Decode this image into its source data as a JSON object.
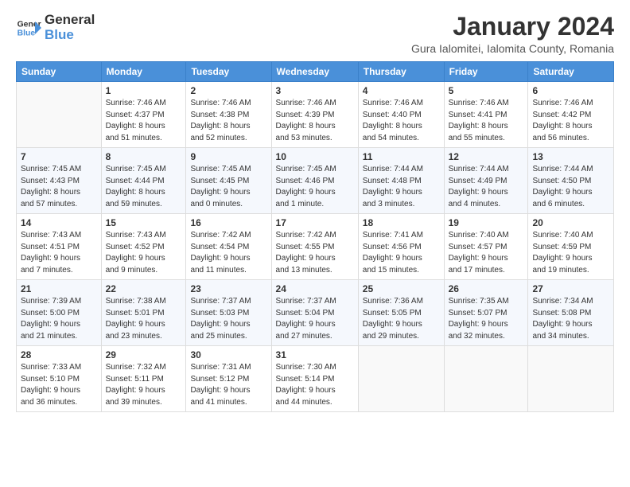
{
  "logo": {
    "line1": "General",
    "line2": "Blue"
  },
  "title": "January 2024",
  "subtitle": "Gura Ialomitei, Ialomita County, Romania",
  "headers": [
    "Sunday",
    "Monday",
    "Tuesday",
    "Wednesday",
    "Thursday",
    "Friday",
    "Saturday"
  ],
  "weeks": [
    [
      {
        "day": "",
        "info": ""
      },
      {
        "day": "1",
        "info": "Sunrise: 7:46 AM\nSunset: 4:37 PM\nDaylight: 8 hours\nand 51 minutes."
      },
      {
        "day": "2",
        "info": "Sunrise: 7:46 AM\nSunset: 4:38 PM\nDaylight: 8 hours\nand 52 minutes."
      },
      {
        "day": "3",
        "info": "Sunrise: 7:46 AM\nSunset: 4:39 PM\nDaylight: 8 hours\nand 53 minutes."
      },
      {
        "day": "4",
        "info": "Sunrise: 7:46 AM\nSunset: 4:40 PM\nDaylight: 8 hours\nand 54 minutes."
      },
      {
        "day": "5",
        "info": "Sunrise: 7:46 AM\nSunset: 4:41 PM\nDaylight: 8 hours\nand 55 minutes."
      },
      {
        "day": "6",
        "info": "Sunrise: 7:46 AM\nSunset: 4:42 PM\nDaylight: 8 hours\nand 56 minutes."
      }
    ],
    [
      {
        "day": "7",
        "info": "Sunrise: 7:45 AM\nSunset: 4:43 PM\nDaylight: 8 hours\nand 57 minutes."
      },
      {
        "day": "8",
        "info": "Sunrise: 7:45 AM\nSunset: 4:44 PM\nDaylight: 8 hours\nand 59 minutes."
      },
      {
        "day": "9",
        "info": "Sunrise: 7:45 AM\nSunset: 4:45 PM\nDaylight: 9 hours\nand 0 minutes."
      },
      {
        "day": "10",
        "info": "Sunrise: 7:45 AM\nSunset: 4:46 PM\nDaylight: 9 hours\nand 1 minute."
      },
      {
        "day": "11",
        "info": "Sunrise: 7:44 AM\nSunset: 4:48 PM\nDaylight: 9 hours\nand 3 minutes."
      },
      {
        "day": "12",
        "info": "Sunrise: 7:44 AM\nSunset: 4:49 PM\nDaylight: 9 hours\nand 4 minutes."
      },
      {
        "day": "13",
        "info": "Sunrise: 7:44 AM\nSunset: 4:50 PM\nDaylight: 9 hours\nand 6 minutes."
      }
    ],
    [
      {
        "day": "14",
        "info": "Sunrise: 7:43 AM\nSunset: 4:51 PM\nDaylight: 9 hours\nand 7 minutes."
      },
      {
        "day": "15",
        "info": "Sunrise: 7:43 AM\nSunset: 4:52 PM\nDaylight: 9 hours\nand 9 minutes."
      },
      {
        "day": "16",
        "info": "Sunrise: 7:42 AM\nSunset: 4:54 PM\nDaylight: 9 hours\nand 11 minutes."
      },
      {
        "day": "17",
        "info": "Sunrise: 7:42 AM\nSunset: 4:55 PM\nDaylight: 9 hours\nand 13 minutes."
      },
      {
        "day": "18",
        "info": "Sunrise: 7:41 AM\nSunset: 4:56 PM\nDaylight: 9 hours\nand 15 minutes."
      },
      {
        "day": "19",
        "info": "Sunrise: 7:40 AM\nSunset: 4:57 PM\nDaylight: 9 hours\nand 17 minutes."
      },
      {
        "day": "20",
        "info": "Sunrise: 7:40 AM\nSunset: 4:59 PM\nDaylight: 9 hours\nand 19 minutes."
      }
    ],
    [
      {
        "day": "21",
        "info": "Sunrise: 7:39 AM\nSunset: 5:00 PM\nDaylight: 9 hours\nand 21 minutes."
      },
      {
        "day": "22",
        "info": "Sunrise: 7:38 AM\nSunset: 5:01 PM\nDaylight: 9 hours\nand 23 minutes."
      },
      {
        "day": "23",
        "info": "Sunrise: 7:37 AM\nSunset: 5:03 PM\nDaylight: 9 hours\nand 25 minutes."
      },
      {
        "day": "24",
        "info": "Sunrise: 7:37 AM\nSunset: 5:04 PM\nDaylight: 9 hours\nand 27 minutes."
      },
      {
        "day": "25",
        "info": "Sunrise: 7:36 AM\nSunset: 5:05 PM\nDaylight: 9 hours\nand 29 minutes."
      },
      {
        "day": "26",
        "info": "Sunrise: 7:35 AM\nSunset: 5:07 PM\nDaylight: 9 hours\nand 32 minutes."
      },
      {
        "day": "27",
        "info": "Sunrise: 7:34 AM\nSunset: 5:08 PM\nDaylight: 9 hours\nand 34 minutes."
      }
    ],
    [
      {
        "day": "28",
        "info": "Sunrise: 7:33 AM\nSunset: 5:10 PM\nDaylight: 9 hours\nand 36 minutes."
      },
      {
        "day": "29",
        "info": "Sunrise: 7:32 AM\nSunset: 5:11 PM\nDaylight: 9 hours\nand 39 minutes."
      },
      {
        "day": "30",
        "info": "Sunrise: 7:31 AM\nSunset: 5:12 PM\nDaylight: 9 hours\nand 41 minutes."
      },
      {
        "day": "31",
        "info": "Sunrise: 7:30 AM\nSunset: 5:14 PM\nDaylight: 9 hours\nand 44 minutes."
      },
      {
        "day": "",
        "info": ""
      },
      {
        "day": "",
        "info": ""
      },
      {
        "day": "",
        "info": ""
      }
    ]
  ]
}
